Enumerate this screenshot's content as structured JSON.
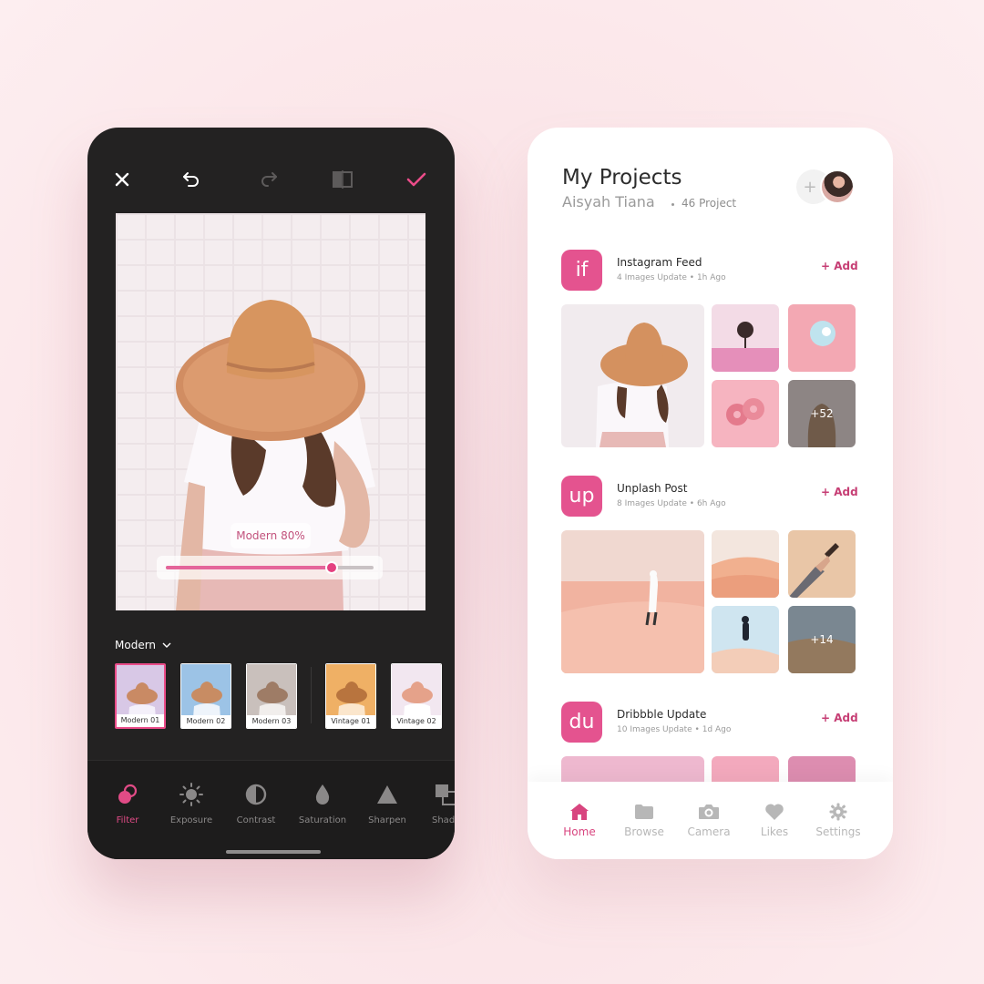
{
  "colors": {
    "accent": "#e4538f",
    "dark_bg": "#232222",
    "light_bg": "#ffffff"
  },
  "editor": {
    "toolbar": {
      "close_icon": "close-icon",
      "undo_icon": "undo-icon",
      "redo_icon": "redo-icon",
      "compare_icon": "compare-icon",
      "confirm_icon": "check-icon"
    },
    "filter_overlay": {
      "label": "Modern 80%",
      "intensity_percent": 80
    },
    "filter_group": {
      "label": "Modern",
      "chevron": "chevron-down-icon"
    },
    "filters": [
      {
        "label": "Modern 01",
        "selected": true
      },
      {
        "label": "Modern 02",
        "selected": false
      },
      {
        "label": "Modern 03",
        "selected": false
      },
      {
        "label": "Vintage 01",
        "selected": false
      },
      {
        "label": "Vintage 02",
        "selected": false
      }
    ],
    "tools": [
      {
        "label": "Filter",
        "icon": "filter-icon",
        "active": true
      },
      {
        "label": "Exposure",
        "icon": "sun-icon",
        "active": false
      },
      {
        "label": "Contrast",
        "icon": "contrast-icon",
        "active": false
      },
      {
        "label": "Saturation",
        "icon": "drop-icon",
        "active": false
      },
      {
        "label": "Sharpen",
        "icon": "triangle-icon",
        "active": false
      },
      {
        "label": "Shad",
        "icon": "shadow-icon",
        "active": false
      }
    ]
  },
  "projects": {
    "header": {
      "title": "My Projects",
      "user": "Aisyah Tiana",
      "count": "46 Project"
    },
    "sections": [
      {
        "icon": "if",
        "title": "Instagram Feed",
        "meta": "4 Images Update",
        "time": "1h Ago",
        "add": "+ Add",
        "more": "+52"
      },
      {
        "icon": "up",
        "title": "Unplash Post",
        "meta": "8 Images Update",
        "time": "6h Ago",
        "add": "+ Add",
        "more": "+14"
      },
      {
        "icon": "du",
        "title": "Dribbble Update",
        "meta": "10 Images Update",
        "time": "1d Ago",
        "add": "+ Add"
      }
    ],
    "nav": [
      {
        "label": "Home",
        "icon": "home-icon",
        "active": true
      },
      {
        "label": "Browse",
        "icon": "folder-icon",
        "active": false
      },
      {
        "label": "Camera",
        "icon": "camera-icon",
        "active": false
      },
      {
        "label": "Likes",
        "icon": "heart-icon",
        "active": false
      },
      {
        "label": "Settings",
        "icon": "gear-icon",
        "active": false
      }
    ]
  }
}
